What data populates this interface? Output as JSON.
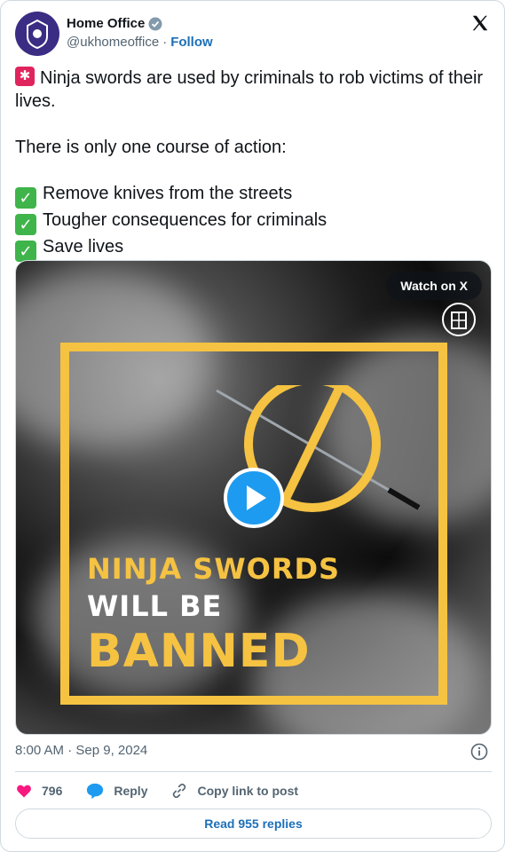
{
  "header": {
    "name": "Home Office",
    "handle": "@ukhomeoffice",
    "separator": "·",
    "follow_label": "Follow"
  },
  "tweet": {
    "line1": "Ninja swords are used by criminals to rob victims of their lives.",
    "line2": "There is only one course of action:",
    "items": [
      "Remove knives from the streets",
      "Tougher consequences for criminals",
      "Save lives"
    ]
  },
  "media": {
    "watch_label": "Watch on X",
    "text_line1": "NINJA SWORDS",
    "text_line2": "WILL BE",
    "text_line3": "BANNED"
  },
  "meta": {
    "timestamp": "8:00 AM · Sep 9, 2024"
  },
  "actions": {
    "likes": "796",
    "reply_label": "Reply",
    "copy_label": "Copy link to post",
    "read_replies_label": "Read 955 replies"
  },
  "colors": {
    "accent": "#1d9bf0",
    "link": "#1d6fb8",
    "like": "#f91880",
    "banner_yellow": "#f5c242",
    "avatar": "#3b2c84"
  }
}
